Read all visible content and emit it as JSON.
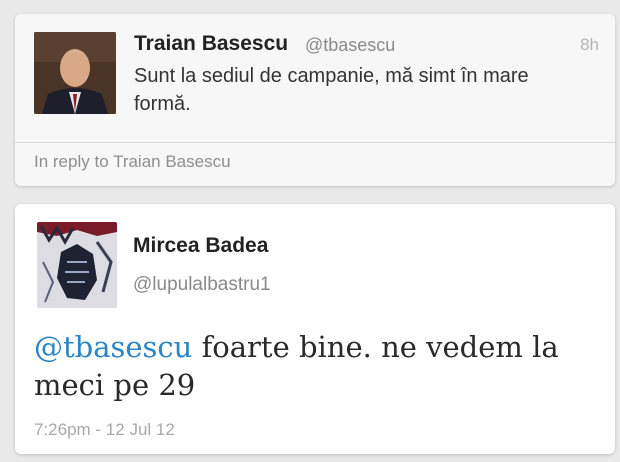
{
  "tweets": [
    {
      "display_name": "Traian Basescu",
      "handle": "@tbasescu",
      "time": "8h",
      "text": "Sunt la sediul de campanie, mă simt în mare formă.",
      "reply_context": "In reply to Traian Basescu"
    },
    {
      "display_name": "Mircea Badea",
      "handle": "@lupulalbastru1",
      "mention": "@tbasescu",
      "text": " foarte bine. ne vedem la meci pe 29",
      "timestamp": "7:26pm - 12 Jul 12"
    }
  ]
}
